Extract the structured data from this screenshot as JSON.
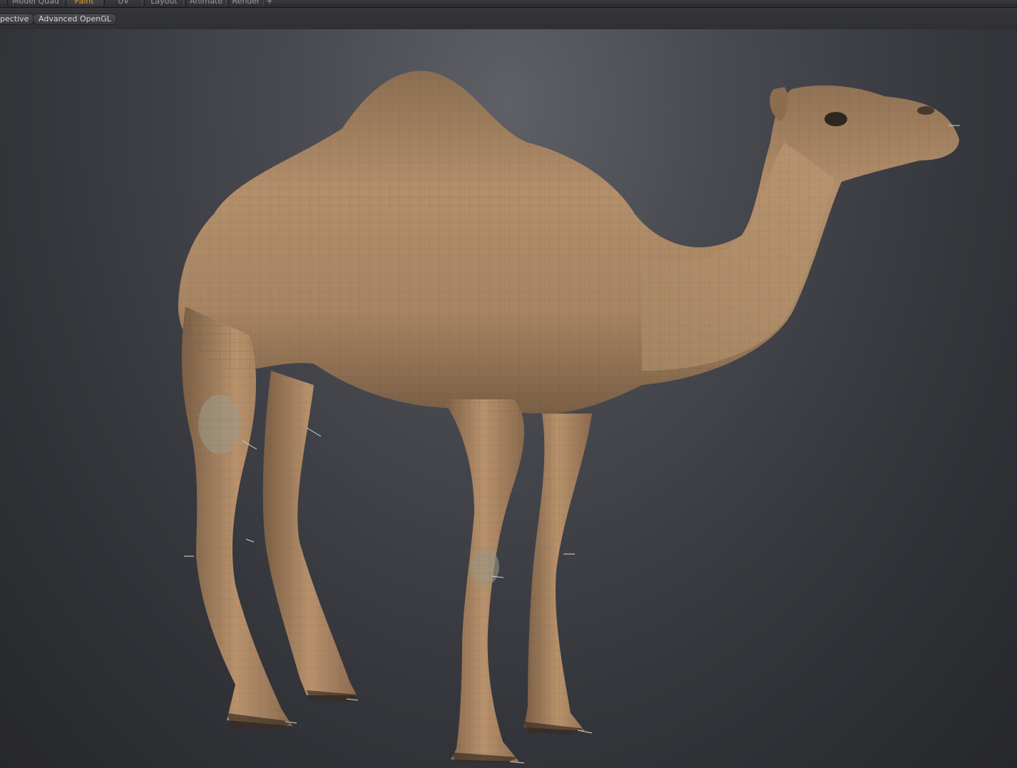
{
  "app": {
    "tabs": [
      {
        "label": "Model Quad",
        "active": false
      },
      {
        "label": "Paint",
        "active": true
      },
      {
        "label": "UV",
        "active": false
      },
      {
        "label": "Layout",
        "active": false
      },
      {
        "label": "Animate",
        "active": false
      },
      {
        "label": "Render",
        "active": false
      }
    ],
    "add_tab_label": "+",
    "active_tab_color": "#e89a2a"
  },
  "viewport_toolbar": {
    "view_mode": "pective",
    "render_mode": "Advanced OpenGL"
  },
  "viewport": {
    "subject": "camel-model",
    "background_color": "#3a3c41",
    "mesh_color": "#b8916a",
    "wireframe_visible": true
  }
}
